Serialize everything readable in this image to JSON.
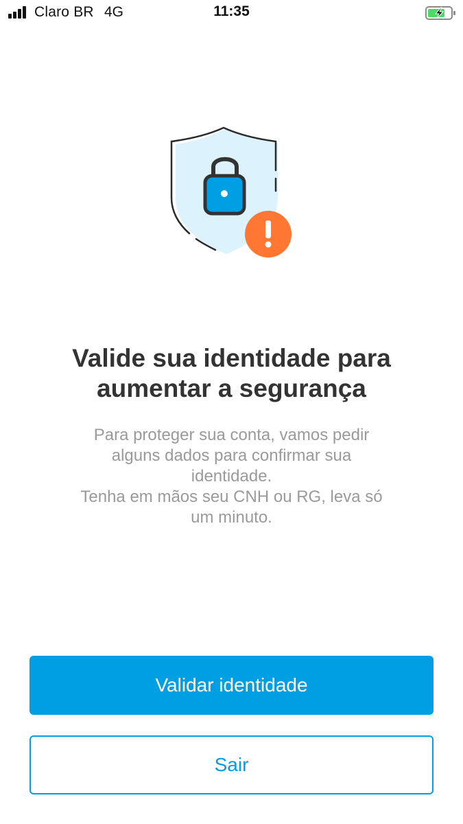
{
  "status_bar": {
    "carrier": "Claro BR",
    "network": "4G",
    "time": "11:35",
    "icons": [
      "signal-icon",
      "battery-charging-icon"
    ]
  },
  "illustration": {
    "icons": [
      "shield-icon",
      "lock-icon",
      "warning-badge-icon"
    ],
    "badge_symbol": "!"
  },
  "content": {
    "title_lines": [
      "Valide sua identidade para",
      "aumentar a segurança"
    ],
    "description_lines": [
      "Para proteger sua conta, vamos pedir",
      "alguns dados para confirmar sua",
      "identidade.",
      "Tenha em mãos seu CNH ou RG, leva só",
      "um minuto."
    ]
  },
  "actions": {
    "primary_label": "Validar identidade",
    "secondary_label": "Sair"
  },
  "colors": {
    "accent": "#009ee3",
    "title": "#333333",
    "description": "#9a9a9a",
    "shield_fill": "#dcf2fd",
    "lock": "#009ee3",
    "warning": "#ff7733",
    "battery": "#4cd964"
  }
}
